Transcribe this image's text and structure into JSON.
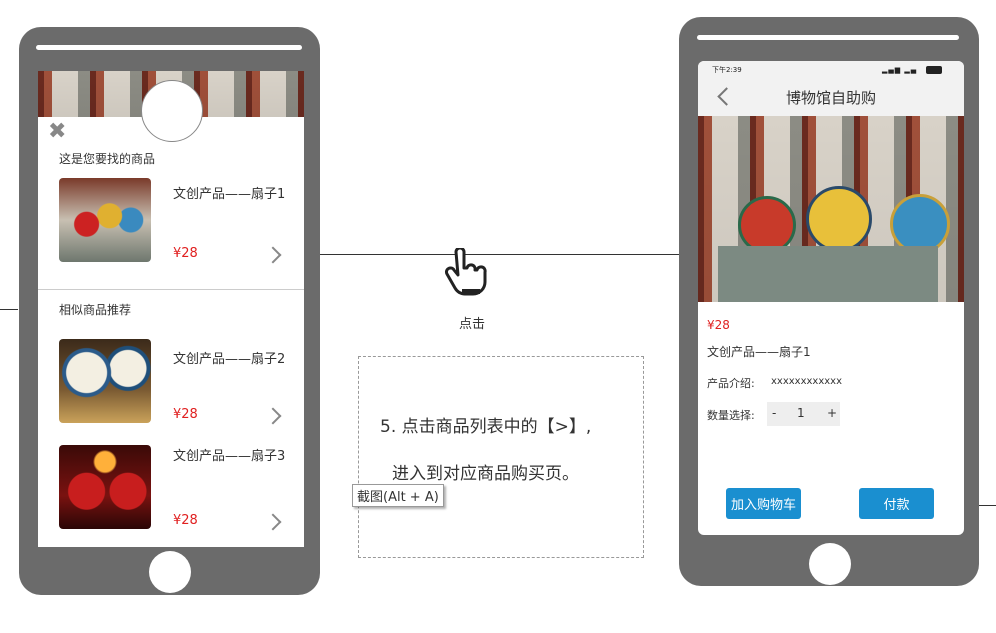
{
  "left_phone": {
    "results_title": "这是您要找的商品",
    "similar_title": "相似商品推荐",
    "products": [
      {
        "name": "文创产品——扇子1",
        "price": "¥28"
      },
      {
        "name": "文创产品——扇子2",
        "price": "¥28"
      },
      {
        "name": "文创产品——扇子3",
        "price": "¥28"
      }
    ]
  },
  "middle": {
    "tap_label": "点击",
    "step_text_line1": "5. 点击商品列表中的【>】,",
    "step_text_line2": "进入到对应商品购买页。",
    "screenshot_tip": "截图(Alt + A)"
  },
  "right_phone": {
    "status_time": "下午2:39",
    "title": "博物馆自助购",
    "price": "¥28",
    "product_name": "文创产品——扇子1",
    "intro_label": "产品介绍:",
    "intro_value": "xxxxxxxxxxxx",
    "qty_label": "数量选择:",
    "qty_minus": "-",
    "qty_value": "1",
    "qty_plus": "+",
    "add_cart": "加入购物车",
    "pay": "付款"
  },
  "colors": {
    "accent": "#1a8fd0",
    "price": "#e02020",
    "frame": "#6b6b6b"
  }
}
